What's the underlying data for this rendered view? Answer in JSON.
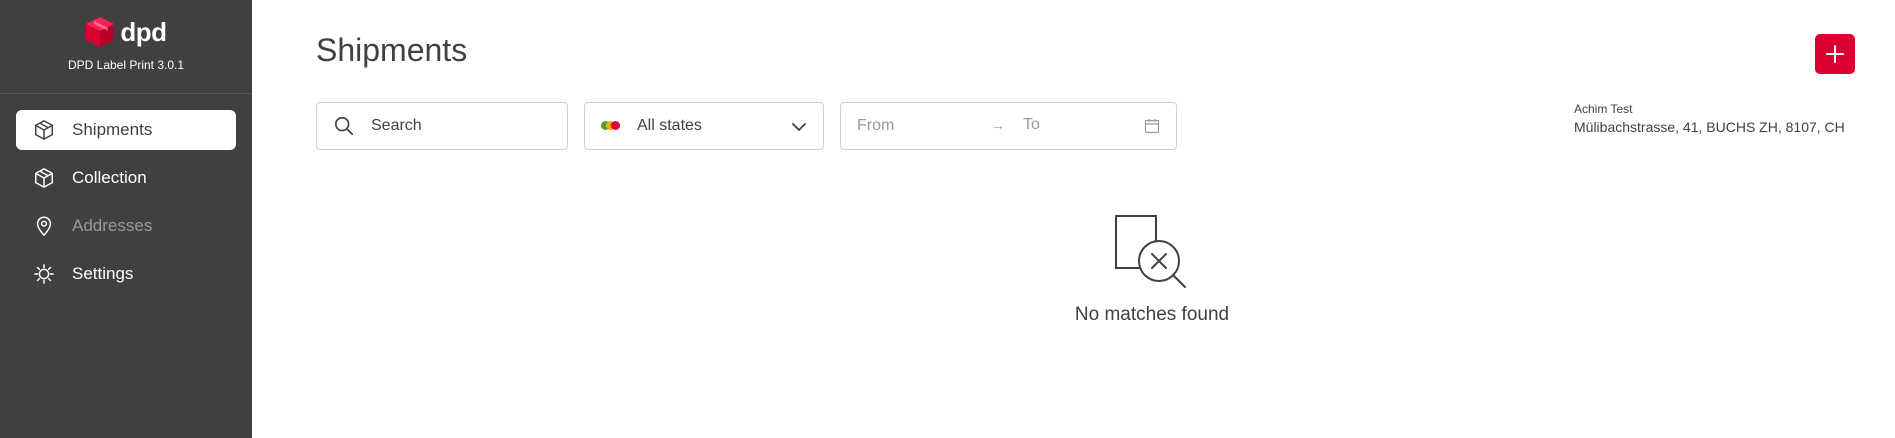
{
  "app": {
    "brand_name": "dpd",
    "version": "DPD Label Print 3.0.1"
  },
  "sidebar": {
    "items": [
      {
        "label": "Shipments",
        "icon": "box-icon",
        "active": true
      },
      {
        "label": "Collection",
        "icon": "box-icon",
        "active": false
      },
      {
        "label": "Addresses",
        "icon": "map-pin-icon",
        "active": false,
        "disabled": true
      },
      {
        "label": "Settings",
        "icon": "gear-icon",
        "active": false
      }
    ]
  },
  "main": {
    "title": "Shipments",
    "add_button_icon": "plus-icon",
    "search": {
      "placeholder": "Search",
      "value": ""
    },
    "state_filter": {
      "selected": "All states",
      "dot_colors": [
        "#509e2f",
        "#ffaa00",
        "#dc0032"
      ]
    },
    "date_range": {
      "from_placeholder": "From",
      "arrow": "→",
      "to_placeholder": "To"
    },
    "account": {
      "name": "Achim Test",
      "address": "Mülibachstrasse, 41, BUCHS ZH, 8107, CH"
    },
    "empty_state": {
      "icon": "no-results-icon",
      "message": "No matches found"
    }
  },
  "colors": {
    "sidebar_bg": "#404040",
    "accent": "#dc0032",
    "text": "#414042"
  }
}
